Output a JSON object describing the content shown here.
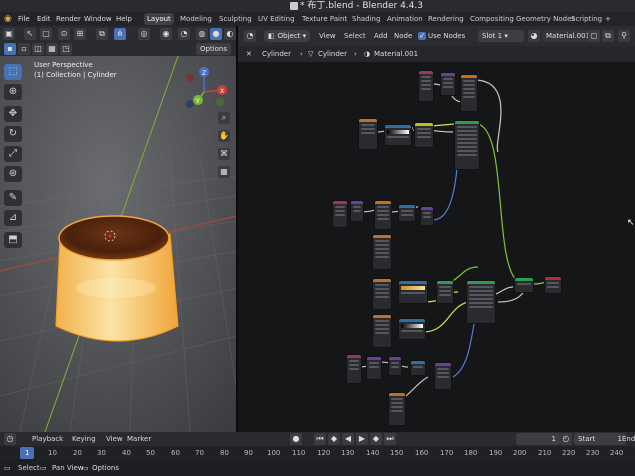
{
  "window": {
    "title": "* 布丁.blend - Blender 4.4.3"
  },
  "menu": [
    "File",
    "Edit",
    "Render",
    "Window",
    "Help"
  ],
  "workspaces": [
    "Layout",
    "Modeling",
    "Sculpting",
    "UV Editing",
    "Texture Paint",
    "Shading",
    "Animation",
    "Rendering",
    "Compositing",
    "Geometry Nodes",
    "Scripting"
  ],
  "workspace_add": "+",
  "viewport": {
    "options_label": "Options",
    "overlay_line1": "User Perspective",
    "overlay_line2": "(1) Collection | Cylinder",
    "gizmo": {
      "x": "X",
      "y": "Y",
      "z": "Z"
    }
  },
  "node_editor": {
    "object_dropdown": "Object",
    "menus": [
      "View",
      "Select",
      "Add",
      "Node"
    ],
    "use_nodes_label": "Use Nodes",
    "slot_label": "Slot 1",
    "material_name": "Material.001",
    "breadcrumb": [
      "Cylinder",
      "Cylinder",
      "Material.001"
    ]
  },
  "timeline": {
    "menus": [
      "Playback",
      "Keying",
      "View",
      "Marker"
    ],
    "current_frame": "1",
    "start_label": "Start",
    "start_value": "1",
    "end_label": "End",
    "ticks": [
      "1",
      "10",
      "20",
      "30",
      "40",
      "50",
      "60",
      "70",
      "80",
      "90",
      "100",
      "110",
      "120",
      "130",
      "140",
      "150",
      "160",
      "170",
      "180",
      "190",
      "200",
      "210",
      "220",
      "230",
      "240"
    ]
  },
  "statusbar": {
    "items": [
      "Select",
      "Pan View",
      "Options"
    ]
  },
  "colors": {
    "accent": "#4772b3",
    "cylinder_rim": "#f0a93a",
    "caramel": "#5a2a10",
    "axis_red": "#c8403a",
    "axis_green": "#7bb83a"
  }
}
